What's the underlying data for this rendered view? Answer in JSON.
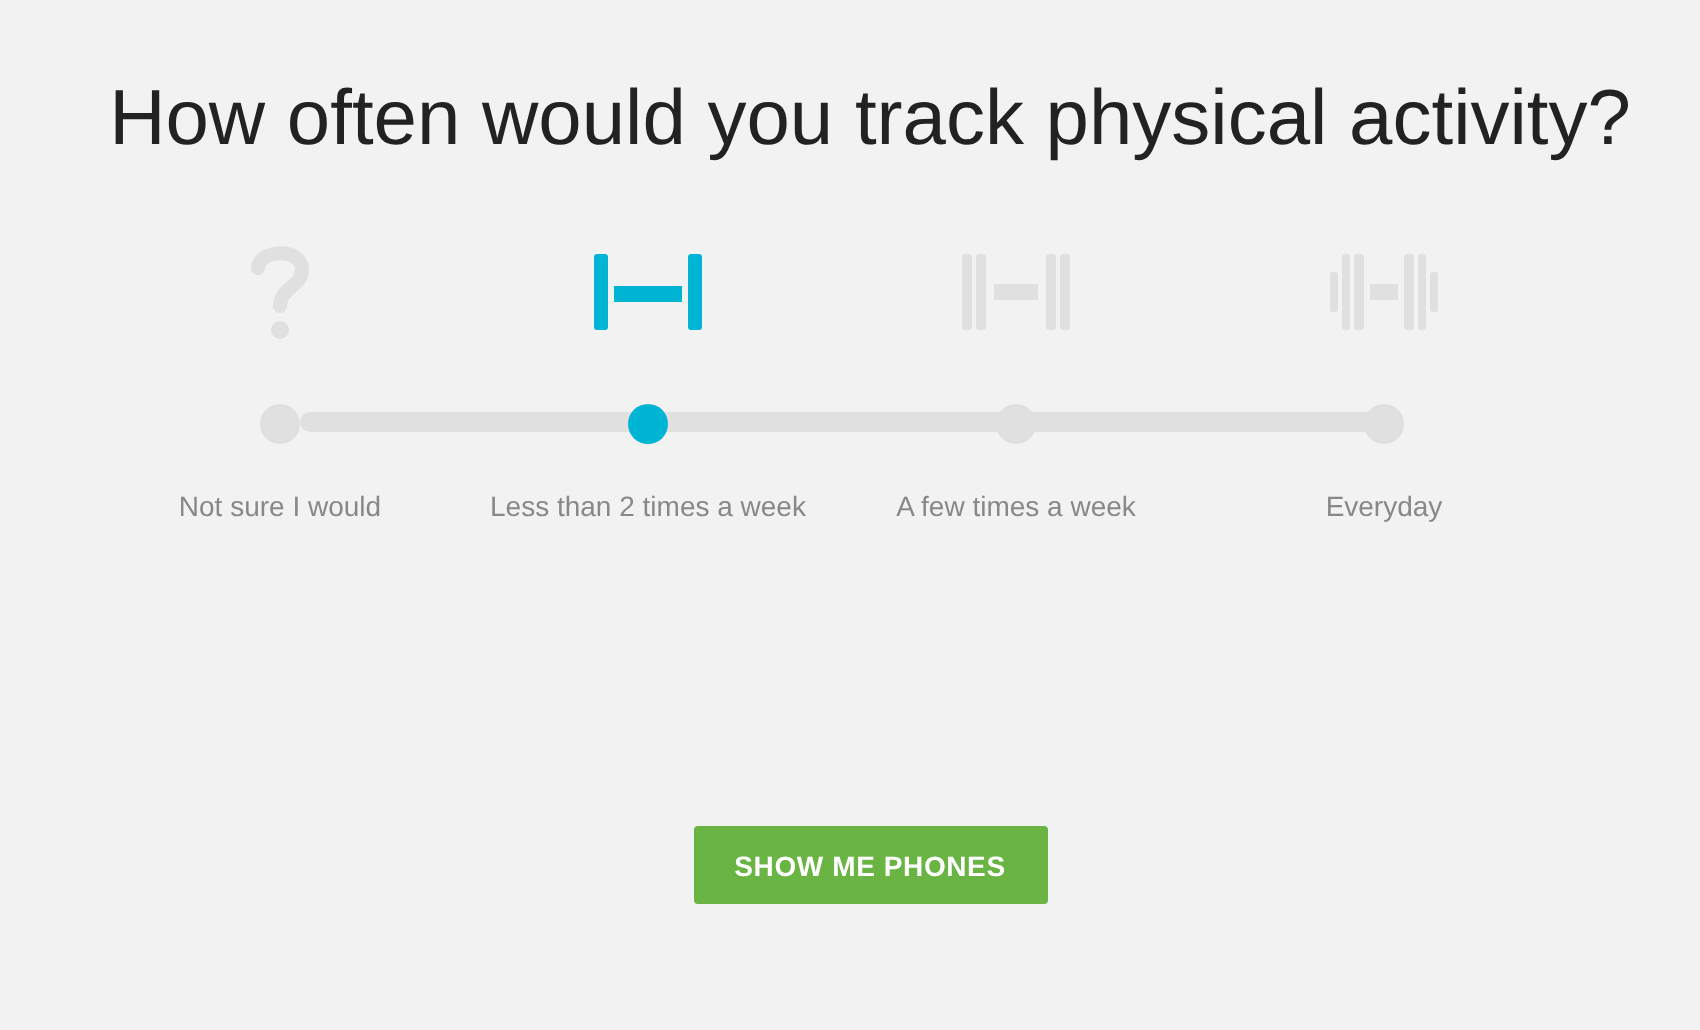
{
  "title": "How often would you track physical activity?",
  "options": [
    {
      "kind": "question",
      "label": "Not sure I would",
      "selected": false
    },
    {
      "kind": "light",
      "label": "Less than 2 times a week",
      "selected": true
    },
    {
      "kind": "medium",
      "label": "A few times a week",
      "selected": false
    },
    {
      "kind": "heavy",
      "label": "Everyday",
      "selected": false
    }
  ],
  "button": "SHOW ME PHONES"
}
